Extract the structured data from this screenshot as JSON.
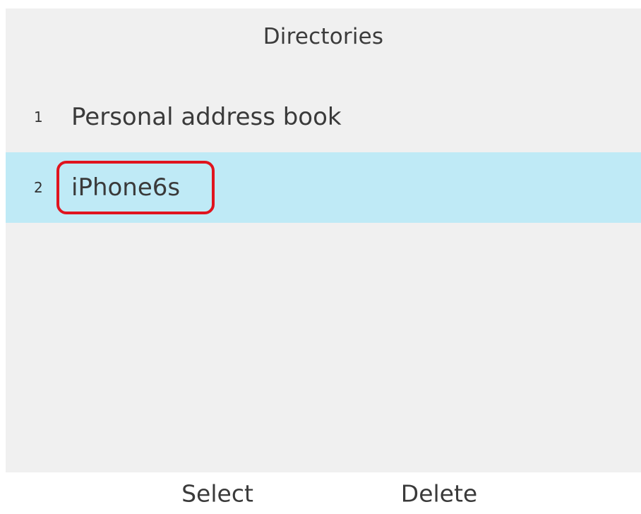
{
  "header": {
    "title": "Directories"
  },
  "directories": {
    "items": [
      {
        "index": "1",
        "label": "Personal address book",
        "selected": false
      },
      {
        "index": "2",
        "label": "iPhone6s",
        "selected": true
      }
    ]
  },
  "softkeys": {
    "select_label": "Select",
    "delete_label": "Delete"
  },
  "colors": {
    "screen_background": "#f0f0f0",
    "selection_highlight": "#bfeaf6",
    "annotation_outline": "#e0141e"
  }
}
